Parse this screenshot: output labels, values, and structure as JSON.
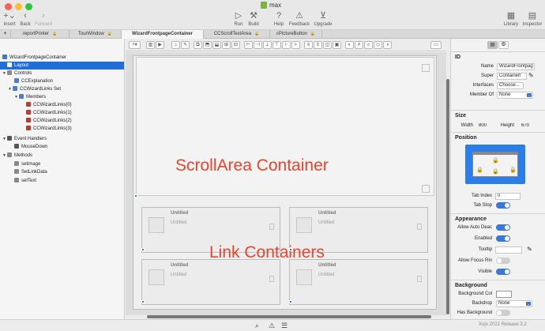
{
  "window": {
    "title": "max"
  },
  "toolbar": {
    "insert": "Insert",
    "back": "Back",
    "forward": "Forward",
    "run": "Run",
    "build": "Build",
    "help": "Help",
    "feedback": "Feedback",
    "upgrade": "Upgrade",
    "library": "Library",
    "inspector": "Inspector"
  },
  "tabs": [
    {
      "label": "+"
    },
    {
      "label": "reportPrinter"
    },
    {
      "label": "TourWindow"
    },
    {
      "label": "WizardFrontpageContainer"
    },
    {
      "label": "CCScrollTextArea"
    },
    {
      "label": "cPictureButton"
    }
  ],
  "navigator": {
    "root": "WizardFrontpageContainer",
    "layout": "Layout",
    "controls": "Controls",
    "explanation": "CCExplanation",
    "links_set": "CCWizardLinks Set",
    "members": "Members",
    "links": [
      "CCWizardLinks(0)",
      "CCWizardLinks(1)",
      "CCWizardLinks(2)",
      "CCWizardLinks(3)"
    ],
    "event_handlers": "Event Handlers",
    "mousedown": "MouseDown",
    "methods": "Methods",
    "method_items": [
      "setimage",
      "SetLinkData",
      "setText"
    ]
  },
  "canvas": {
    "scroll_label": "ScrollArea Container",
    "link_label": "Link Containers",
    "card_title": "Untitled",
    "card_sub": "Untitled"
  },
  "inspector": {
    "id_header": "ID",
    "name_label": "Name",
    "name_value": "WizardFrontpag",
    "super_label": "Super",
    "super_value": "Containerl",
    "interfaces_label": "Interfaces",
    "interfaces_value": "Choose...",
    "member_label": "Member Of",
    "member_value": "None",
    "size_header": "Size",
    "width_label": "Width",
    "width_value": "800",
    "height_label": "Height",
    "height_value": "670",
    "position_header": "Position",
    "tabindex_label": "Tab Index",
    "tabindex_value": "0",
    "tabstop_label": "Tab Stop",
    "appearance_header": "Appearance",
    "autodeac_label": "Allow Auto Deac",
    "enabled_label": "Enabled",
    "tooltip_label": "Tooltip",
    "focus_label": "Allow Focus Rin",
    "visible_label": "Visible",
    "background_header": "Background",
    "bgcolor_label": "Background Col",
    "backdrop_label": "Backdrop",
    "backdrop_value": "None",
    "hasbg_label": "Has Background"
  },
  "status": {
    "release": "Xojo 2022 Release 3.2"
  },
  "colors": {
    "accent": "#3a78d8",
    "annotation": "#e8452c"
  }
}
